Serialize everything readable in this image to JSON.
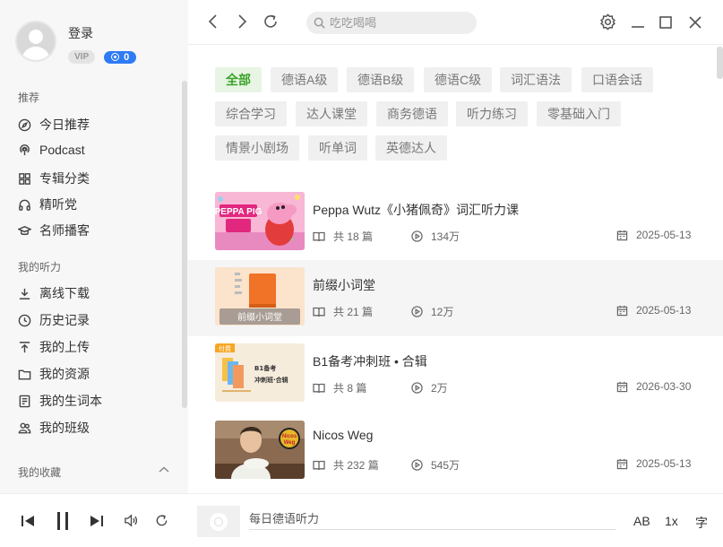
{
  "user": {
    "login": "登录",
    "vip": "VIP",
    "coins": "0"
  },
  "sidebar": {
    "sections": [
      {
        "title": "推荐",
        "items": [
          {
            "label": "今日推荐",
            "icon": "compass-icon"
          },
          {
            "label": "Podcast",
            "icon": "podcast-icon"
          },
          {
            "label": "专辑分类",
            "icon": "grid-icon"
          },
          {
            "label": "精听党",
            "icon": "headphones-icon"
          },
          {
            "label": "名师播客",
            "icon": "graduation-cap-icon"
          }
        ]
      },
      {
        "title": "我的听力",
        "items": [
          {
            "label": "离线下载",
            "icon": "download-icon"
          },
          {
            "label": "历史记录",
            "icon": "clock-icon"
          },
          {
            "label": "我的上传",
            "icon": "upload-icon"
          },
          {
            "label": "我的资源",
            "icon": "folder-icon"
          },
          {
            "label": "我的生词本",
            "icon": "notebook-icon"
          },
          {
            "label": "我的班级",
            "icon": "users-icon"
          }
        ]
      },
      {
        "title": "我的收藏",
        "items": []
      }
    ]
  },
  "search": {
    "placeholder": "吃吃喝喝"
  },
  "tags": [
    "全部",
    "德语A级",
    "德语B级",
    "德语C级",
    "词汇语法",
    "口语会话",
    "综合学习",
    "达人课堂",
    "商务德语",
    "听力练习",
    "零基础入门",
    "情景小剧场",
    "听单词",
    "英德达人"
  ],
  "active_tag": "全部",
  "albums": [
    {
      "title": "Peppa Wutz《小猪佩奇》词汇听力课",
      "episodes": "共 18 篇",
      "plays": "134万",
      "date": "2025-05-13",
      "thumb_text": "PEPPA PIG"
    },
    {
      "title": "前缀小词堂",
      "episodes": "共 21 篇",
      "plays": "12万",
      "date": "2025-05-13",
      "thumb_text": "前缀小词堂"
    },
    {
      "title": "B1备考冲刺班 • 合辑",
      "episodes": "共 8 篇",
      "plays": "2万",
      "date": "2026-03-30",
      "thumb_text": "B1备考 冲刺班·合辑",
      "badge": "付费"
    },
    {
      "title": "Nicos Weg",
      "episodes": "共 232 篇",
      "plays": "545万",
      "date": "2025-05-13",
      "thumb_text": "Nicos Weg"
    }
  ],
  "player": {
    "track": "每日德语听力",
    "ab": "AB",
    "speed": "1x",
    "subtitle": "字"
  }
}
